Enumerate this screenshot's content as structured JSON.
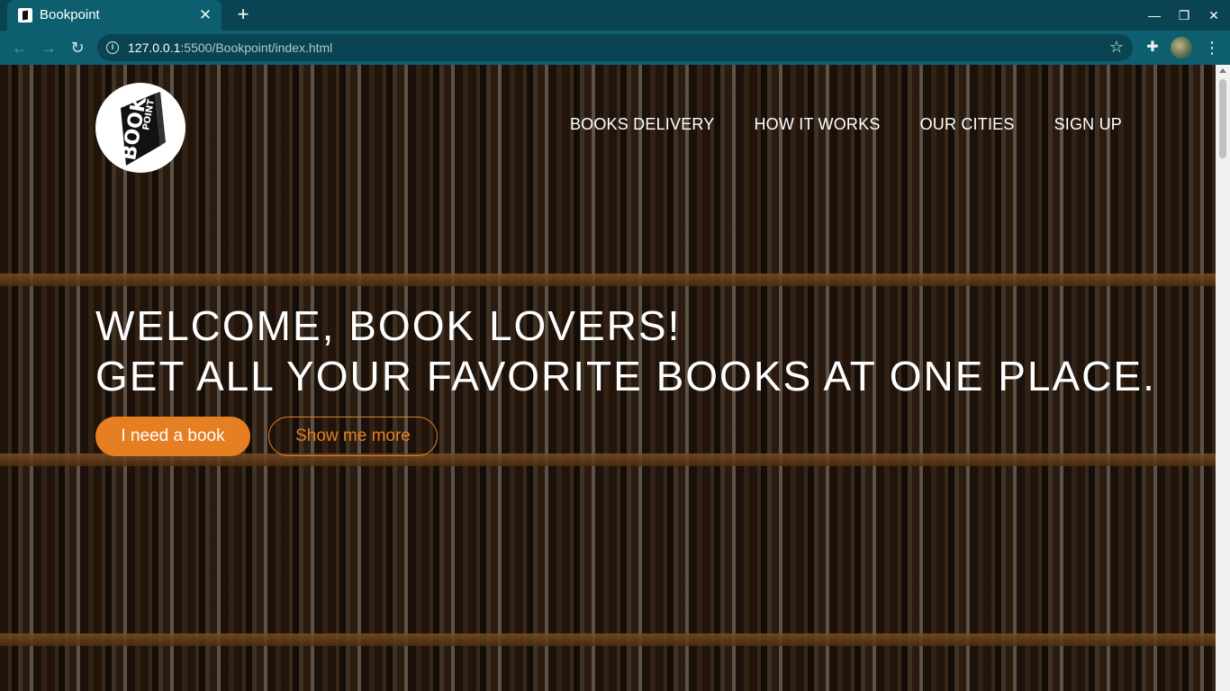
{
  "browser": {
    "tab_title": "Bookpoint",
    "url_host": "127.0.0.1",
    "url_path": ":5500/Bookpoint/index.html",
    "icons": [
      "back-icon",
      "forward-icon",
      "reload-icon",
      "info-icon",
      "star-icon",
      "extensions-icon",
      "profile-avatar",
      "menu-icon"
    ]
  },
  "logo": {
    "text_top": "POINT",
    "text_side": "BOOK"
  },
  "nav": {
    "items": [
      "BOOKS DELIVERY",
      "HOW IT WORKS",
      "OUR CITIES",
      "SIGN UP"
    ]
  },
  "hero": {
    "line1": "WELCOME, BOOK LOVERS!",
    "line2": "GET ALL YOUR FAVORITE BOOKS AT ONE PLACE.",
    "primary_button": "I need a book",
    "secondary_button": "Show me more"
  },
  "colors": {
    "accent": "#e67e22",
    "chrome": "#0d5f6f",
    "chrome_dark": "#0a4452"
  }
}
